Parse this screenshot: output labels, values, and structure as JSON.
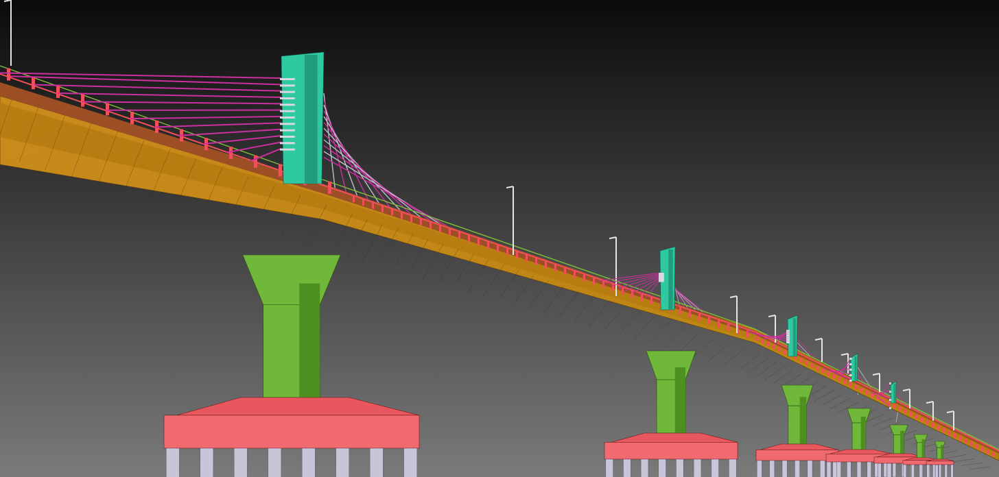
{
  "viewport": {
    "background_top": "#0b0b0b",
    "background_bottom": "#7a7a7a"
  },
  "colors": {
    "deck_top": "#c8871a",
    "deck_side": "#b37a12",
    "deck_edge": "#9c4e24",
    "railing": "#f0505a",
    "pylon": "#2ec9a0",
    "pylon_dark": "#1f9d7c",
    "cable_front": "#cc2fa0",
    "cable_back": "#bfbfcf",
    "pier_light": "#6fb83a",
    "pier_dark": "#4e8f22",
    "pile_cap_top": "#e8575e",
    "pile_cap_side": "#f06a70",
    "pile": "#c9c4d8",
    "light_pole": "#e6e6e6",
    "line": "#3a2a10"
  },
  "model": {
    "object": "cable-stayed-bridge",
    "pylon_count": 5,
    "pier_count": 7
  }
}
